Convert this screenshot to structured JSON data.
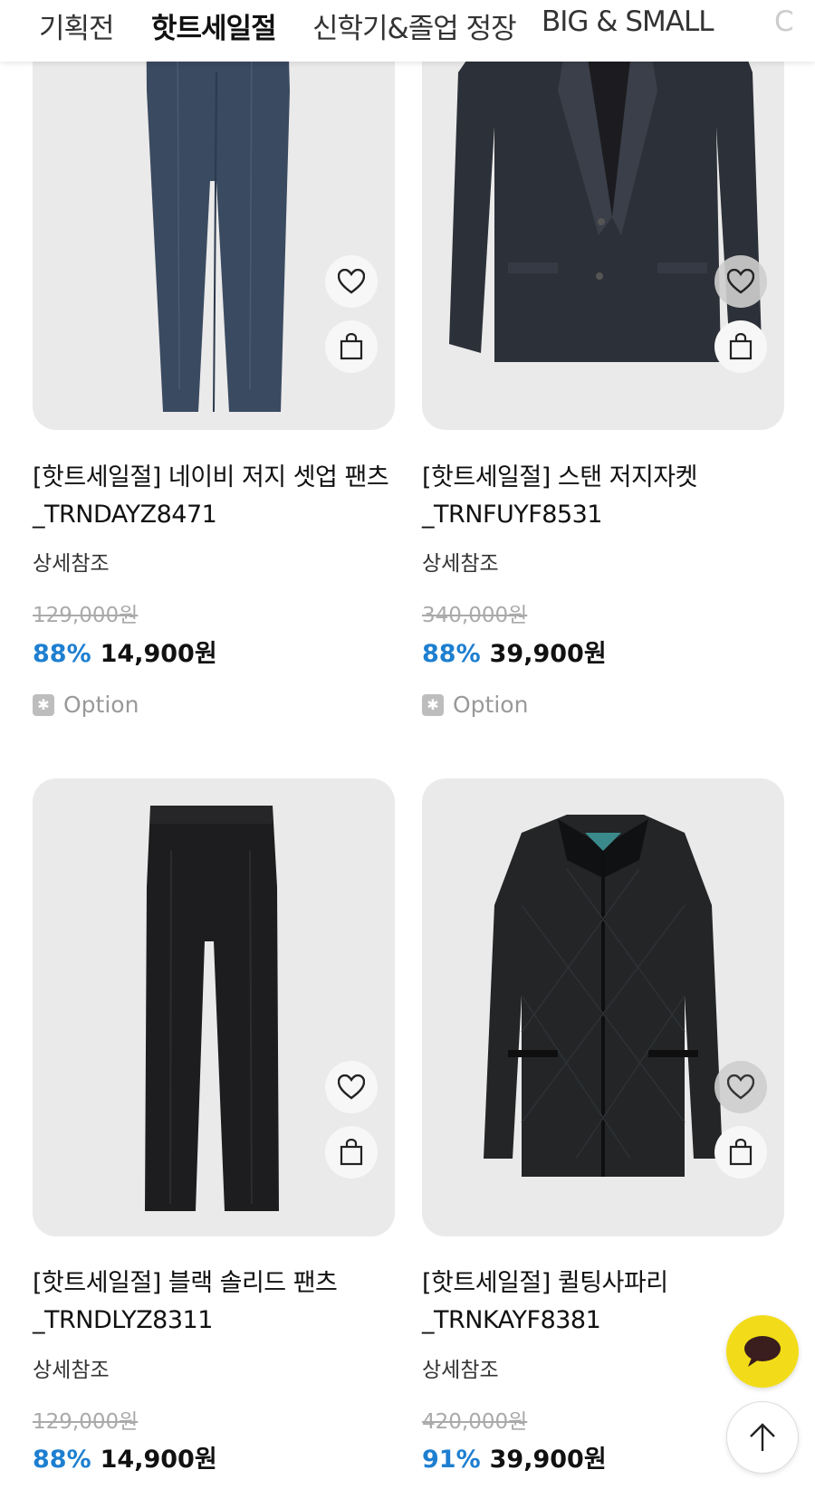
{
  "nav": {
    "tabs": [
      {
        "label": "기획전",
        "active": false
      },
      {
        "label": "핫트세일절",
        "active": true
      },
      {
        "label": "신학기&졸업 정장",
        "active": false
      },
      {
        "label": "BIG & SMALL",
        "active": false
      },
      {
        "label": "C",
        "active": false
      }
    ]
  },
  "products": [
    {
      "title_line1": "[핫트세일절] 네이비 저지 셋업 팬츠",
      "title_line2": "_TRNDAYZ8471",
      "subtitle": "상세참조",
      "original_price": "129,000원",
      "discount": "88%",
      "price": "14,900원",
      "option_label": "Option",
      "icons": [
        "heart-icon",
        "shopping-bag-icon"
      ]
    },
    {
      "title_line1": "[핫트세일절] 스탠 저지자켓",
      "title_line2": "_TRNFUYF8531",
      "subtitle": "상세참조",
      "original_price": "340,000원",
      "discount": "88%",
      "price": "39,900원",
      "option_label": "Option",
      "icons": [
        "heart-icon",
        "shopping-bag-icon"
      ]
    },
    {
      "title_line1": "[핫트세일절] 블랙 솔리드 팬츠",
      "title_line2": "_TRNDLYZ8311",
      "subtitle": "상세참조",
      "original_price": "129,000원",
      "discount": "88%",
      "price": "14,900원",
      "icons": [
        "heart-icon",
        "shopping-bag-icon"
      ]
    },
    {
      "title_line1": "[핫트세일절] 퀼팅사파리",
      "title_line2": "_TRNKAYF8381",
      "subtitle": "상세참조",
      "original_price": "420,000원",
      "discount": "91%",
      "price": "39,900원",
      "icons": [
        "heart-icon",
        "shopping-bag-icon"
      ]
    }
  ],
  "floating": {
    "chat_icon": "speech-bubble-icon",
    "top_icon": "arrow-up-icon"
  },
  "colors": {
    "discount": "#1e7fd0",
    "chat_button": "#f2dc19",
    "image_background": "#ebeaea"
  }
}
